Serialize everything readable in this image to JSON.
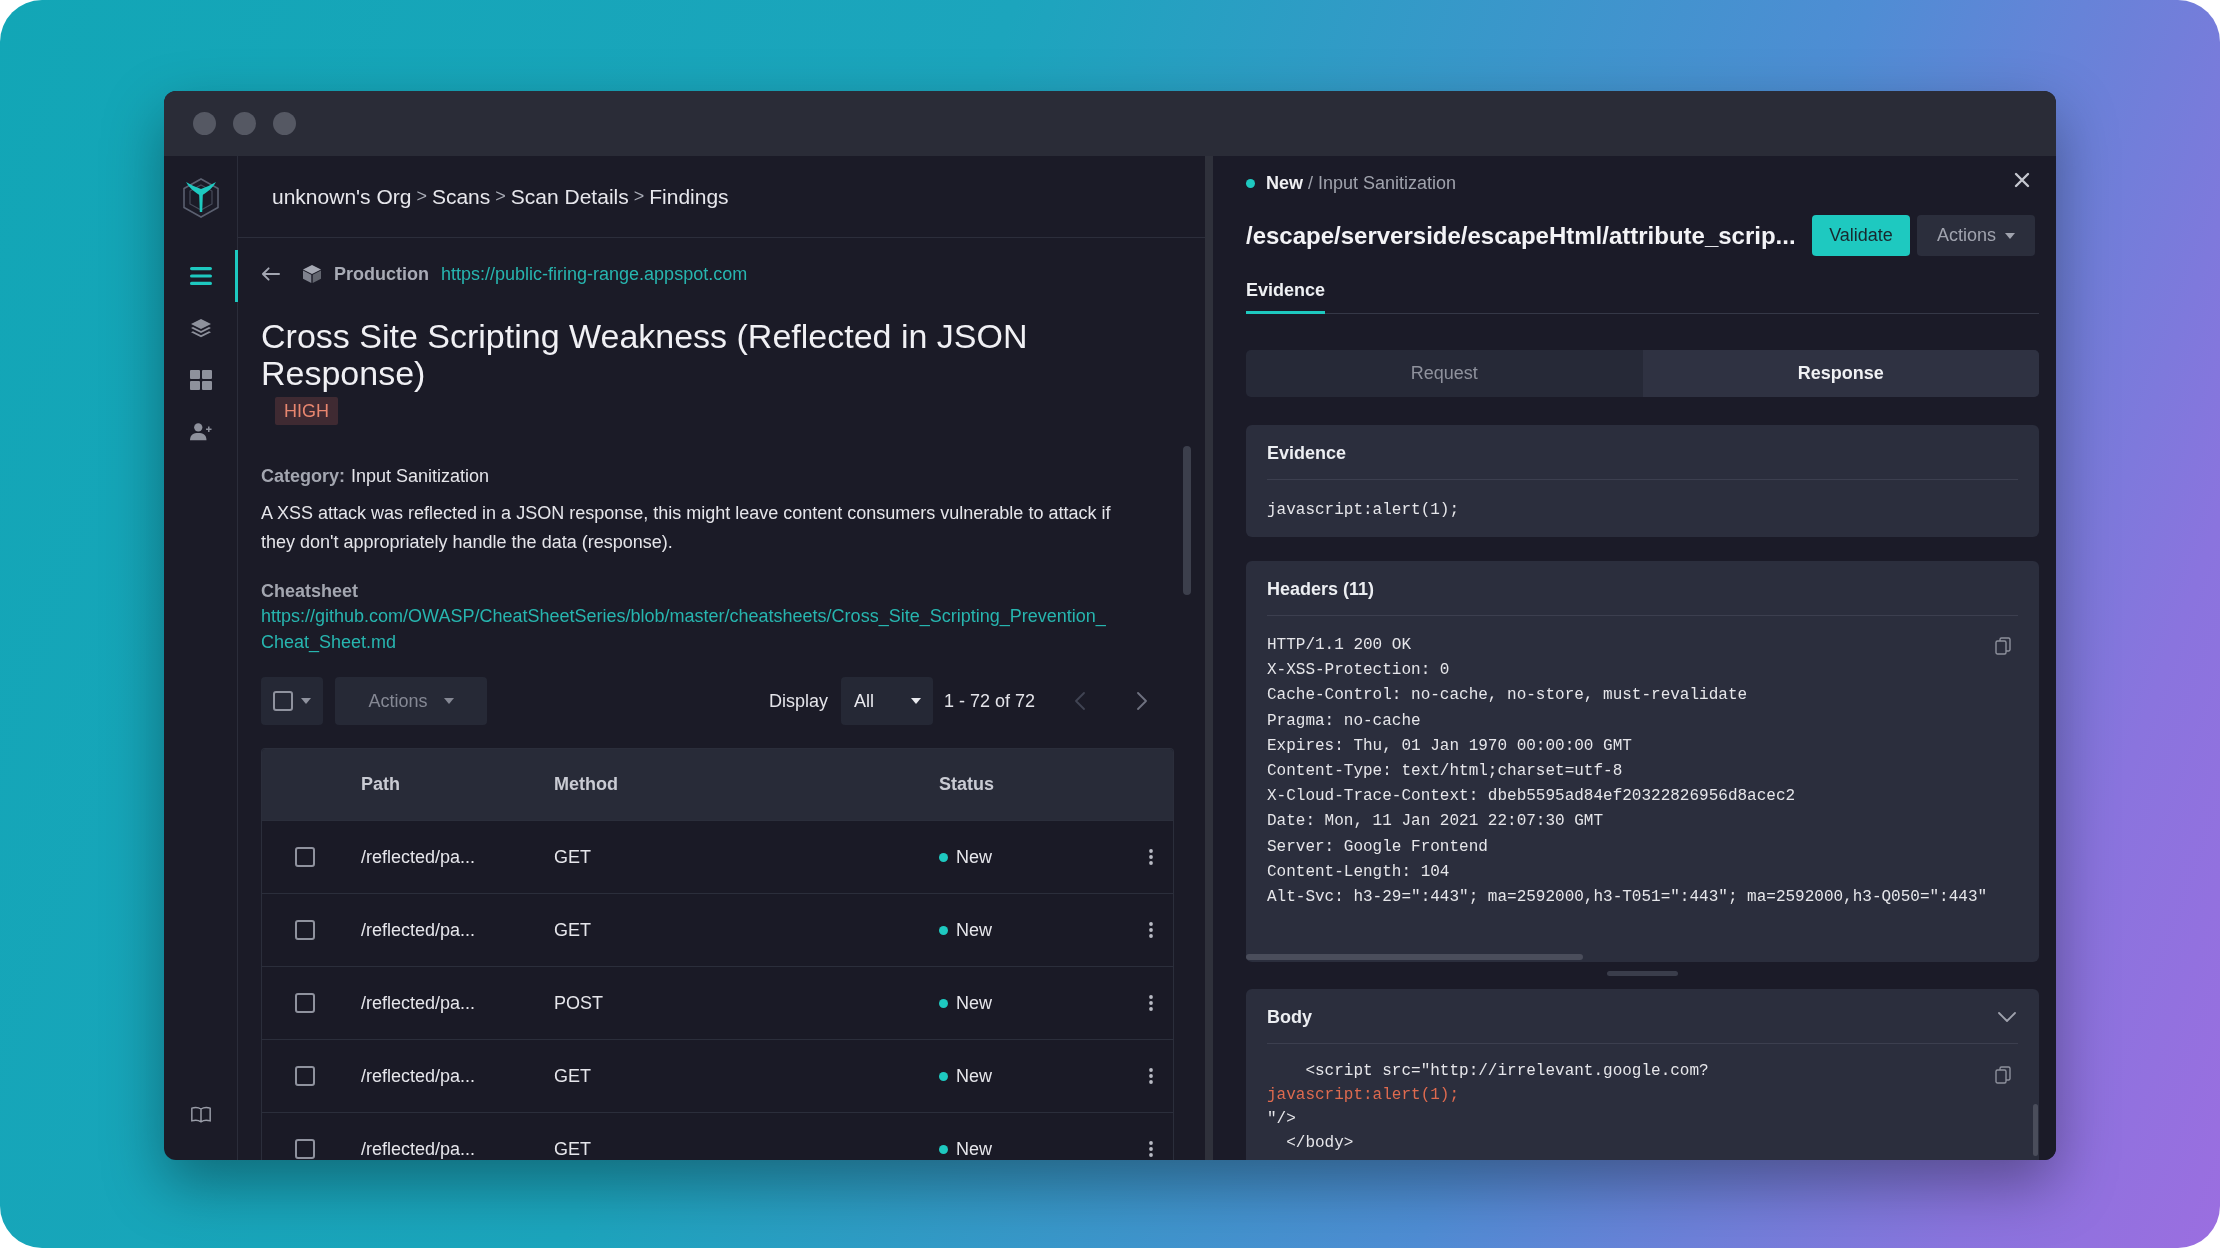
{
  "sidebar": {
    "items": [
      {
        "selected": true
      },
      {
        "selected": false
      },
      {
        "selected": false
      },
      {
        "selected": false
      }
    ]
  },
  "breadcrumb": [
    {
      "label": "unknown's Org",
      "separator": ">"
    },
    {
      "label": "Scans",
      "separator": ">"
    },
    {
      "label": "Scan Details",
      "separator": ">"
    },
    {
      "label": "Findings"
    }
  ],
  "finding": {
    "environment": "Production",
    "url": "https://public-firing-range.appspot.com",
    "title": "Cross Site Scripting Weakness (Reflected in JSON Response)",
    "severity": "HIGH",
    "category_label": "Category:",
    "category": "Input Sanitization",
    "description": "A XSS attack was reflected in a JSON response, this might leave content consumers vulnerable to attack if they don't appropriately handle the data (response).",
    "cheatsheet_label": "Cheatsheet",
    "cheatsheet_url": "https://github.com/OWASP/CheatSheetSeries/blob/master/cheatsheets/Cross_Site_Scripting_Prevention_Cheat_Sheet.md"
  },
  "toolbar": {
    "select_all": {
      "checked": false
    },
    "actions": {
      "label": "Actions",
      "disabled": true
    },
    "display_label": "Display",
    "display": {
      "value": "All"
    },
    "range": "1 - 72 of 72",
    "prev": {
      "disabled": true
    },
    "next": {
      "disabled": false
    }
  },
  "table": {
    "columns": [
      "Path",
      "Method",
      "Status"
    ],
    "rows": [
      {
        "checked": false,
        "path": "/reflected/pa...",
        "method": "GET",
        "status": {
          "label": "New",
          "color": "#1ec9c0"
        }
      },
      {
        "checked": false,
        "path": "/reflected/pa...",
        "method": "GET",
        "status": {
          "label": "New",
          "color": "#1ec9c0"
        }
      },
      {
        "checked": false,
        "path": "/reflected/pa...",
        "method": "POST",
        "status": {
          "label": "New",
          "color": "#1ec9c0"
        }
      },
      {
        "checked": false,
        "path": "/reflected/pa...",
        "method": "GET",
        "status": {
          "label": "New",
          "color": "#1ec9c0"
        }
      },
      {
        "checked": false,
        "path": "/reflected/pa...",
        "method": "GET",
        "status": {
          "label": "New",
          "color": "#1ec9c0"
        }
      }
    ]
  },
  "detail": {
    "status": {
      "label": "New",
      "color": "#1ec9c0"
    },
    "separator": "/",
    "category": "Input Sanitization",
    "title": "/escape/serverside/escapeHtml/attribute_scrip...",
    "validate": "Validate",
    "actions": "Actions",
    "tabs": [
      {
        "label": "Evidence",
        "selected": true
      }
    ],
    "segments": [
      {
        "label": "Request",
        "selected": false
      },
      {
        "label": "Response",
        "selected": true
      }
    ],
    "evidence": {
      "title": "Evidence",
      "code": "javascript:alert(1);"
    },
    "headers": {
      "title": "Headers (11)",
      "lines": [
        "HTTP/1.1 200 OK",
        "X-XSS-Protection: 0",
        "Cache-Control: no-cache, no-store, must-revalidate",
        "Pragma: no-cache",
        "Expires: Thu, 01 Jan 1970 00:00:00 GMT",
        "Content-Type: text/html;charset=utf-8",
        "X-Cloud-Trace-Context: dbeb5595ad84ef20322826956d8acec2",
        "Date: Mon, 11 Jan 2021 22:07:30 GMT",
        "Server: Google Frontend",
        "Content-Length: 104",
        "Alt-Svc: h3-29=\":443\"; ma=2592000,h3-T051=\":443\"; ma=2592000,h3-Q050=\":443\""
      ]
    },
    "body": {
      "title": "Body",
      "expanded": true,
      "lines": [
        {
          "text": "    <script src=\"http://irrelevant.google.com?",
          "highlight": false
        },
        {
          "text": "javascript:alert(1);",
          "highlight": true
        },
        {
          "text": "\"/>",
          "highlight": false
        },
        {
          "text": "  </body>",
          "highlight": false
        }
      ]
    }
  }
}
